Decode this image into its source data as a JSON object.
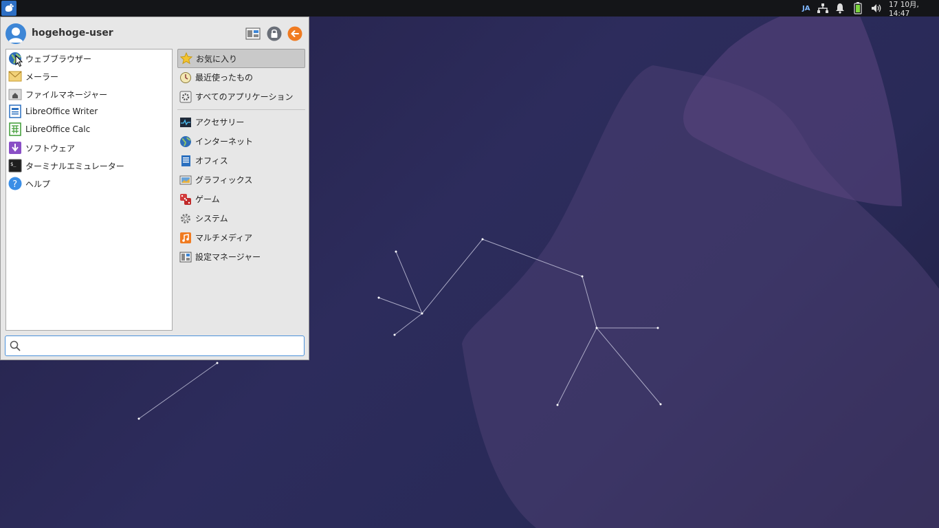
{
  "panel": {
    "keyboard_layout": "JA",
    "clock": "17 10月, 14:47"
  },
  "menu": {
    "username": "hogehoge-user",
    "favorites": [
      {
        "label": "ウェブブラウザー",
        "icon": "web-browser-icon"
      },
      {
        "label": "メーラー",
        "icon": "mail-icon"
      },
      {
        "label": "ファイルマネージャー",
        "icon": "file-manager-icon"
      },
      {
        "label": "LibreOffice Writer",
        "icon": "writer-icon"
      },
      {
        "label": "LibreOffice Calc",
        "icon": "calc-icon"
      },
      {
        "label": "ソフトウェア",
        "icon": "software-icon"
      },
      {
        "label": "ターミナルエミュレーター",
        "icon": "terminal-icon"
      },
      {
        "label": "ヘルプ",
        "icon": "help-icon"
      }
    ],
    "categories_top": [
      {
        "label": "お気に入り",
        "icon": "star-icon",
        "selected": true
      },
      {
        "label": "最近使ったもの",
        "icon": "recent-icon"
      },
      {
        "label": "すべてのアプリケーション",
        "icon": "all-apps-icon"
      }
    ],
    "categories": [
      {
        "label": "アクセサリー",
        "icon": "accessories-icon"
      },
      {
        "label": "インターネット",
        "icon": "internet-icon"
      },
      {
        "label": "オフィス",
        "icon": "office-icon"
      },
      {
        "label": "グラフィックス",
        "icon": "graphics-icon"
      },
      {
        "label": "ゲーム",
        "icon": "games-icon"
      },
      {
        "label": "システム",
        "icon": "system-icon"
      },
      {
        "label": "マルチメディア",
        "icon": "multimedia-icon"
      },
      {
        "label": "設定マネージャー",
        "icon": "settings-manager-icon"
      }
    ],
    "search_value": ""
  },
  "colors": {
    "accent": "#4a90d9",
    "panel": "#141518",
    "menu_bg": "#e7e7e7"
  }
}
